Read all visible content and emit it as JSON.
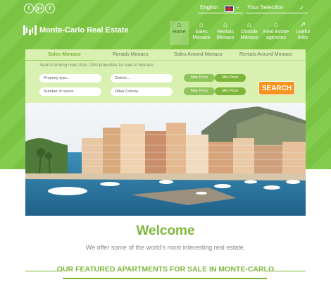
{
  "topbar": {
    "social": [
      {
        "icon": "facebook-icon",
        "glyph": "f"
      },
      {
        "icon": "google-plus-icon",
        "glyph": "g+"
      },
      {
        "icon": "twitter-icon",
        "glyph": "t"
      }
    ],
    "language": "English",
    "selection": "Your Selection"
  },
  "brand": {
    "name": "Monte-Carlo Real Estate"
  },
  "nav": {
    "home": {
      "label": "Home",
      "glyph": "⌂"
    },
    "sales": {
      "line1": "Sales",
      "line2": "Monaco",
      "glyph": "⌂"
    },
    "rentals": {
      "line1": "Rentals",
      "line2": "Monaco",
      "glyph": "⌂"
    },
    "outside": {
      "line1": "Outside",
      "line2": "Monaco",
      "glyph": "⌂"
    },
    "agencies": {
      "line1": "Real Estate",
      "line2": "agencies",
      "glyph": "⌂"
    },
    "links": {
      "line1": "Useful",
      "line2": "links",
      "glyph": "↗"
    }
  },
  "search": {
    "tabs": [
      "Sales Monaco",
      "Rentals Monaco",
      "Sales Around Monaco",
      "Rentals Around Monaco"
    ],
    "hint": "Search among more than 1000 properties for sale in Monaco",
    "property_type": "Property type...",
    "district": "District...",
    "rooms": "Number of rooms",
    "other": "Other Criteria",
    "max_price": "Max Price",
    "min_price": "Min Price",
    "button": "SEARCH"
  },
  "welcome": {
    "title": "Welcome",
    "tagline": "We offer some of the world's most interesting real estate."
  },
  "featured": {
    "title": "OUR FEATURED APARTMENTS FOR SALE IN MONTE-CARLO"
  },
  "colors": {
    "green": "#7ec945",
    "accent": "#7eb63b",
    "orange": "#f7931e"
  }
}
